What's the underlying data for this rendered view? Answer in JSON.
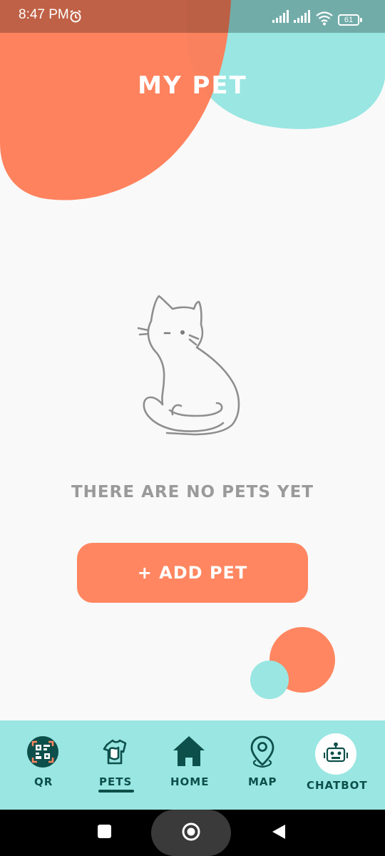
{
  "status_bar": {
    "time": "8:47 PM",
    "battery": "61",
    "icons": [
      "alarm-icon",
      "cell-signal-icon",
      "cell-signal-icon",
      "wifi-icon",
      "battery-icon"
    ]
  },
  "header": {
    "title": "MY PET"
  },
  "empty_state": {
    "illustration": "cat-outline-illustration",
    "message": "THERE ARE NO PETS YET"
  },
  "actions": {
    "add_pet_label": "+ ADD PET"
  },
  "bottom_nav": {
    "items": [
      {
        "label": "QR",
        "icon": "qr-scan-icon",
        "active": false
      },
      {
        "label": "PETS",
        "icon": "pet-shirt-icon",
        "active": true
      },
      {
        "label": "HOME",
        "icon": "house-icon",
        "active": false
      },
      {
        "label": "MAP",
        "icon": "map-pin-icon",
        "active": false
      },
      {
        "label": "CHATBOT",
        "icon": "robot-icon",
        "active": false
      }
    ]
  },
  "system_nav": {
    "icons": [
      "recents-square-icon",
      "home-circle-icon",
      "back-triangle-icon"
    ]
  },
  "colors": {
    "coral": "#ff8660",
    "teal": "#99e6e2",
    "dark_teal": "#0d4f4a",
    "background": "#f9f9f9",
    "muted_text": "#9a9a9a"
  }
}
